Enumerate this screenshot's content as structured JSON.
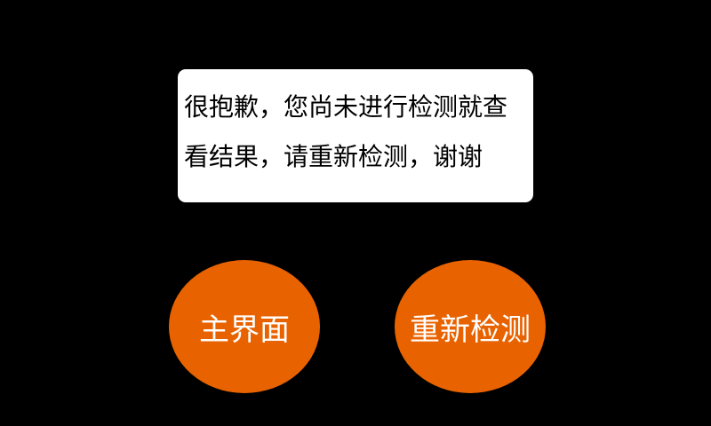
{
  "dialog": {
    "message_line_1": "很抱歉，您尚未进行检测就查",
    "message_line_2": "看结果，请重新检测，谢谢"
  },
  "buttons": {
    "home_label": "主界面",
    "retest_label": "重新检测"
  },
  "colors": {
    "background": "#000000",
    "card": "#ffffff",
    "accent": "#e86300",
    "button_text": "#ffffff"
  }
}
